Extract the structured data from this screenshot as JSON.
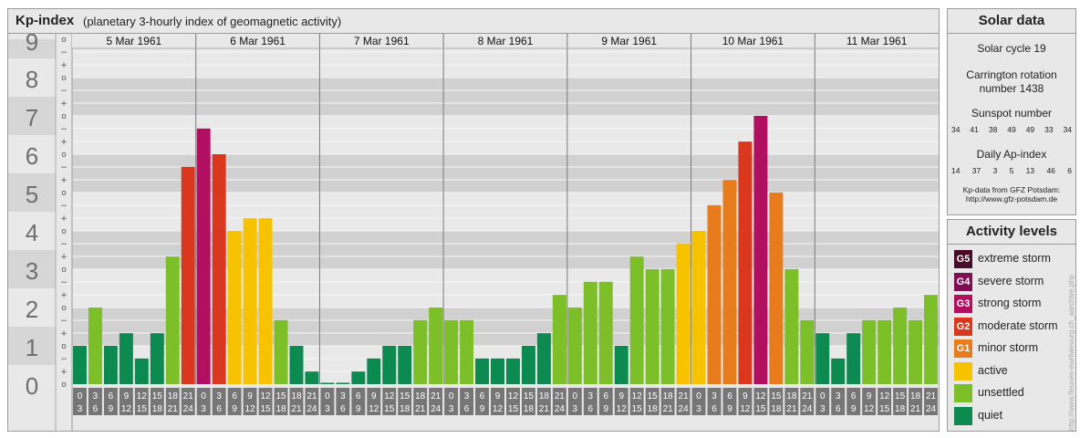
{
  "header": {
    "title": "Kp-index",
    "subtitle": "(planetary 3-hourly index of geomagnetic activity)"
  },
  "solar": {
    "title": "Solar data",
    "cycle": "Solar cycle 19",
    "carrington_line1": "Carrington rotation",
    "carrington_line2": "number 1438",
    "sunspot_title": "Sunspot number",
    "sunspot_values": [
      "34",
      "41",
      "38",
      "49",
      "49",
      "33",
      "34"
    ],
    "ap_title": "Daily Ap-index",
    "ap_values": [
      "14",
      "37",
      "3",
      "5",
      "13",
      "46",
      "6"
    ],
    "credit_line1": "Kp-data from GFZ Potsdam:",
    "credit_line2": "http://www.gfz-potsdam.de"
  },
  "activity": {
    "title": "Activity levels",
    "levels": [
      {
        "code": "G5",
        "label": "extreme storm",
        "color": "#4a0b2a"
      },
      {
        "code": "G4",
        "label": "severe storm",
        "color": "#7d0f52"
      },
      {
        "code": "G3",
        "label": "strong storm",
        "color": "#b0105f"
      },
      {
        "code": "G2",
        "label": "moderate storm",
        "color": "#d9381e"
      },
      {
        "code": "G1",
        "label": "minor storm",
        "color": "#e87b1c"
      },
      {
        "code": "",
        "label": "active",
        "color": "#f7c200"
      },
      {
        "code": "",
        "label": "unsettled",
        "color": "#7cbf28"
      },
      {
        "code": "",
        "label": "quiet",
        "color": "#0d8a4f"
      }
    ]
  },
  "side_credit": "http://www.fleunes-ewrliweuurg.ch_aarchive.php",
  "chart_data": {
    "type": "bar",
    "title": "Kp-index",
    "y_range": [
      0,
      9
    ],
    "y_ticks": [
      "0",
      "1",
      "2",
      "3",
      "4",
      "5",
      "6",
      "7",
      "8",
      "9"
    ],
    "minor_marks": [
      "+",
      "o",
      "−"
    ],
    "days": [
      "5 Mar 1961",
      "6 Mar 1961",
      "7 Mar 1961",
      "8 Mar 1961",
      "9 Mar 1961",
      "10 Mar 1961",
      "11 Mar 1961"
    ],
    "interval_start_labels": [
      "0",
      "3",
      "6",
      "9",
      "12",
      "15",
      "18",
      "21"
    ],
    "interval_end_labels": [
      "3",
      "6",
      "9",
      "12",
      "15",
      "18",
      "21",
      "24"
    ],
    "values": [
      1.0,
      2.0,
      1.0,
      1.33,
      0.67,
      1.33,
      3.33,
      5.67,
      6.67,
      6.0,
      4.0,
      4.33,
      4.33,
      1.67,
      1.0,
      0.33,
      0.0,
      0.0,
      0.33,
      0.67,
      1.0,
      1.0,
      1.67,
      2.0,
      1.67,
      1.67,
      0.67,
      0.67,
      0.67,
      1.0,
      1.33,
      2.33,
      2.0,
      2.67,
      2.67,
      1.0,
      3.33,
      3.0,
      3.0,
      3.67,
      4.0,
      4.67,
      5.33,
      6.33,
      7.0,
      5.0,
      3.0,
      1.67,
      1.33,
      0.67,
      1.33,
      1.67,
      1.67,
      2.0,
      1.67,
      2.33
    ],
    "colors": {
      "quiet": "#0d8a4f",
      "unsettled": "#7cbf28",
      "active": "#f7c200",
      "g1": "#e87b1c",
      "g2": "#d9381e",
      "g3": "#b0105f",
      "g4": "#7d0f52",
      "g5": "#4a0b2a",
      "band_dark": "#d1d1d1",
      "band_light": "#e9e9e9",
      "ylabel_dark": "#d6d6d6",
      "ylabel_light": "#e9e9e9",
      "time_box": "#767676"
    }
  }
}
